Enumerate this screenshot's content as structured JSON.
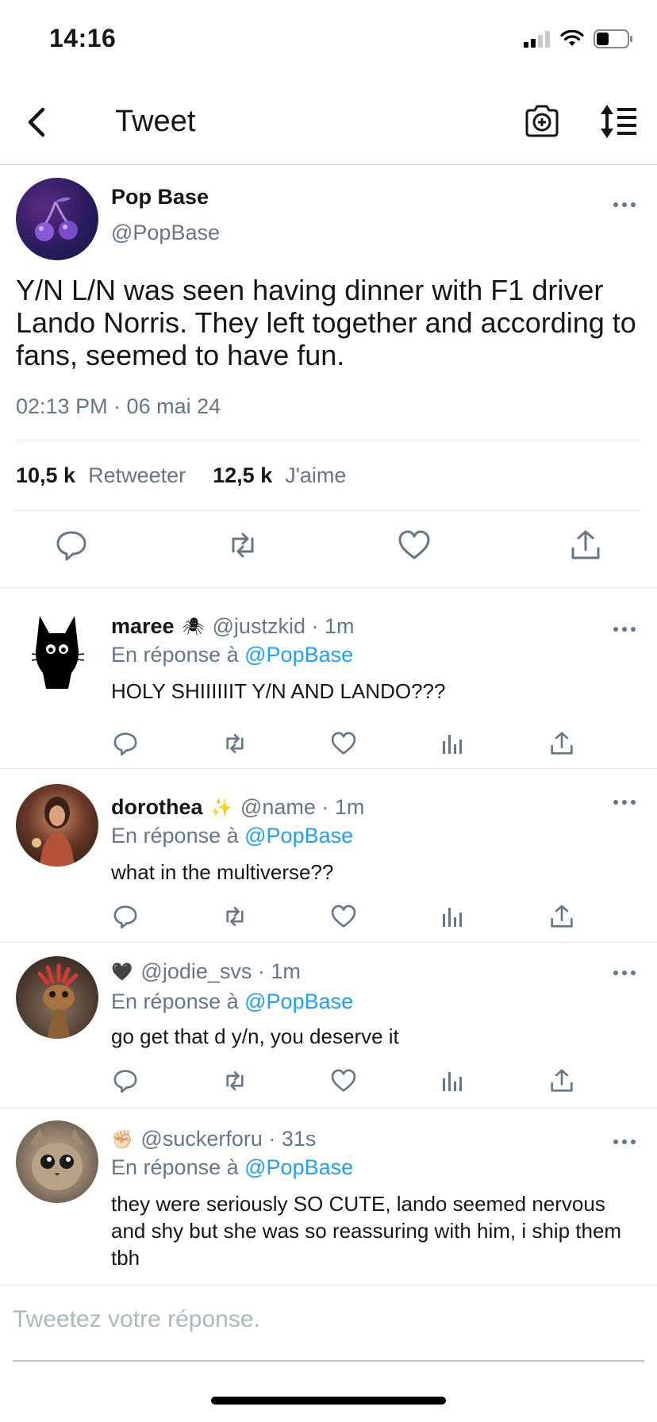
{
  "status_bar": {
    "time": "14:16",
    "signal_icon": "signal-icon",
    "wifi_icon": "wifi-icon",
    "battery_icon": "battery-icon"
  },
  "nav": {
    "title": "Tweet",
    "back_icon": "chevron-left-icon",
    "camera_icon": "camera-icon",
    "sort_icon": "sort-icon"
  },
  "main_tweet": {
    "name": "Pop Base",
    "handle": "@PopBase",
    "text": "Y/N L/N was seen having dinner with F1 driver Lando Norris. They left together and according to fans, seemed to have fun.",
    "timestamp": "02:13 PM · 06 mai 24",
    "retweets_count": "10,5 k",
    "retweets_label": "Retweeter",
    "likes_count": "12,5 k",
    "likes_label": "J'aime"
  },
  "replies": [
    {
      "name": "maree",
      "emoji": "🕷",
      "meta": "@justzkid · 1m",
      "reply_prefix": "En réponse à",
      "reply_to": "@PopBase",
      "text": "HOLY SHIIIIIIT Y/N AND LANDO???"
    },
    {
      "name": "dorothea",
      "emoji": "✨",
      "meta": "@name · 1m",
      "reply_prefix": "En réponse à",
      "reply_to": "@PopBase",
      "text": "what in the multiverse??"
    },
    {
      "name": "",
      "emoji": "🖤",
      "meta": "@jodie_svs · 1m",
      "reply_prefix": "En réponse à",
      "reply_to": "@PopBase",
      "text": "go get that d y/n, you deserve it"
    },
    {
      "name": "",
      "emoji": "✊🏻",
      "meta": "@suckerforu · 31s",
      "reply_prefix": "En réponse à",
      "reply_to": "@PopBase",
      "text": "they were seriously SO CUTE, lando seemed nervous and shy but she was so reassuring with him, i ship them tbh"
    }
  ],
  "compose": {
    "placeholder": "Tweetez votre réponse."
  },
  "colors": {
    "link": "#1da1f2",
    "muted": "#657786",
    "text": "#14171a",
    "divider": "#e1e8ed"
  }
}
